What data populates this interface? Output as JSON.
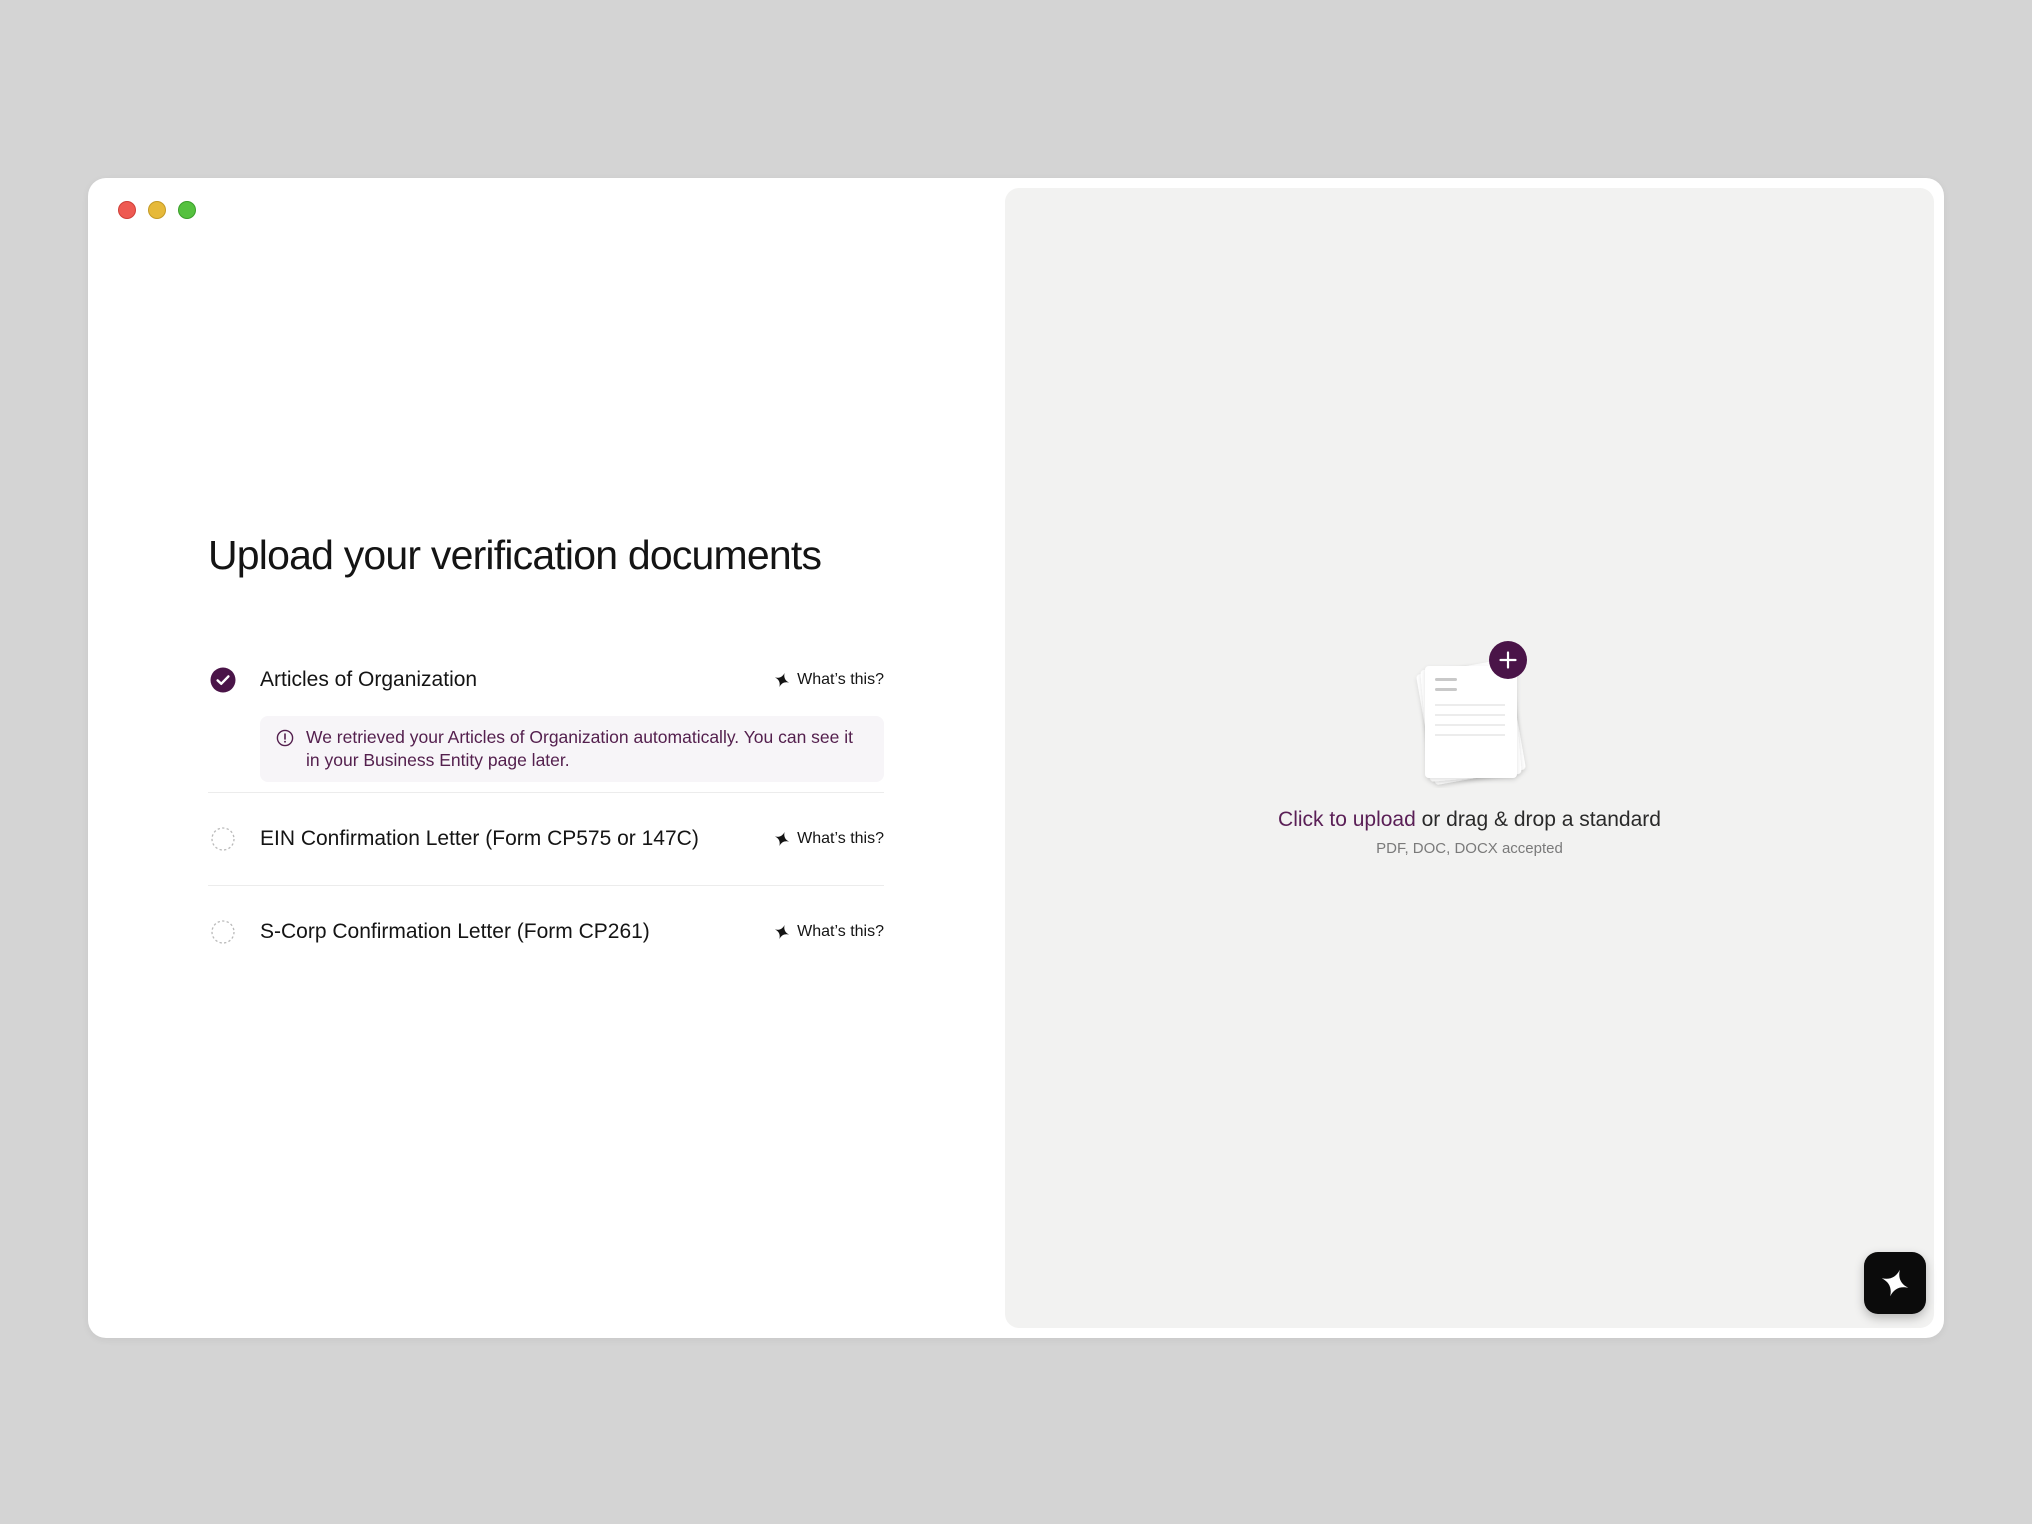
{
  "page": {
    "title": "Upload your verification documents"
  },
  "documents": [
    {
      "name": "Articles of Organization",
      "status": "complete",
      "help_label": "What’s this?",
      "info": "We retrieved your Articles of Organization automatically. You can see it in your Business Entity page later."
    },
    {
      "name": "EIN Confirmation Letter (Form CP575 or 147C)",
      "status": "pending",
      "help_label": "What’s this?"
    },
    {
      "name": "S-Corp Confirmation Letter (Form CP261)",
      "status": "pending",
      "help_label": "What’s this?"
    }
  ],
  "dropzone": {
    "link_text": "Click to upload",
    "rest_text": " or drag & drop a standard",
    "accepted": "PDF, DOC, DOCX accepted"
  },
  "colors": {
    "accent": "#4a1448",
    "background": "#d4d4d4",
    "panel": "#f2f2f1"
  },
  "icons": {
    "complete": "check-circle-icon",
    "pending": "dashed-circle-icon",
    "help": "sparkle-icon",
    "info": "info-icon",
    "add": "plus-icon",
    "assistant": "sparkle-icon"
  }
}
